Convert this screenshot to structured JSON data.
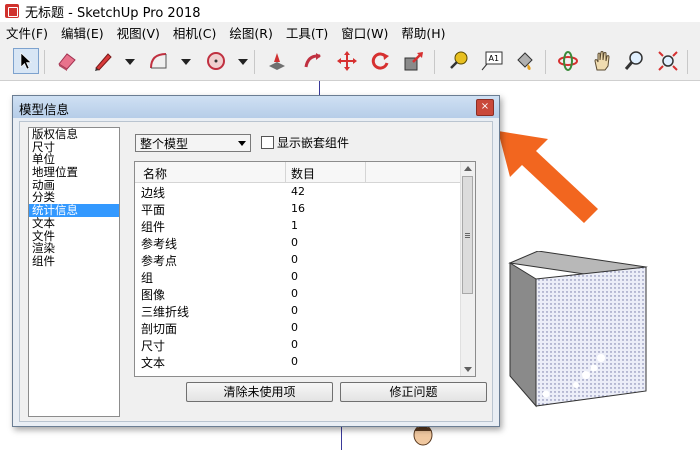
{
  "window": {
    "title": "无标题 - SketchUp Pro 2018"
  },
  "menu": [
    "文件(F)",
    "编辑(E)",
    "视图(V)",
    "相机(C)",
    "绘图(R)",
    "工具(T)",
    "窗口(W)",
    "帮助(H)"
  ],
  "toolbar": {
    "icons": [
      "select-icon",
      "eraser-icon",
      "pencil-icon",
      "arc-icon",
      "circle-icon",
      "push-pull-icon",
      "follow-me-icon",
      "move-icon",
      "rotate-icon",
      "scale-icon",
      "tape-measure-icon",
      "text-icon",
      "paint-bucket-icon",
      "orbit-icon",
      "pan-icon",
      "zoom-icon",
      "zoom-extents-icon"
    ],
    "text_icon_label": "A1"
  },
  "dialog": {
    "title": "模型信息",
    "close_glyph": "×",
    "categories": [
      "版权信息",
      "尺寸",
      "单位",
      "地理位置",
      "动画",
      "分类",
      "统计信息",
      "文本",
      "文件",
      "渲染",
      "组件"
    ],
    "selected_category_index": 6,
    "scope_select": "整个模型",
    "show_nested_label": "显示嵌套组件",
    "show_nested_checked": false,
    "table": {
      "headers": [
        "名称",
        "数目"
      ],
      "rows": [
        {
          "name": "边线",
          "count": "42"
        },
        {
          "name": "平面",
          "count": "16"
        },
        {
          "name": "组件",
          "count": "1"
        },
        {
          "name": "参考线",
          "count": "0"
        },
        {
          "name": "参考点",
          "count": "0"
        },
        {
          "name": "组",
          "count": "0"
        },
        {
          "name": "图像",
          "count": "0"
        },
        {
          "name": "三维折线",
          "count": "0"
        },
        {
          "name": "剖切面",
          "count": "0"
        },
        {
          "name": "尺寸",
          "count": "0"
        },
        {
          "name": "文本",
          "count": "0"
        }
      ]
    },
    "purge_button": "清除未使用项",
    "fix_button": "修正问题"
  },
  "colors": {
    "accent_arrow": "#f2661f",
    "selection": "#3399ff",
    "cube_face": "#eceef8"
  }
}
